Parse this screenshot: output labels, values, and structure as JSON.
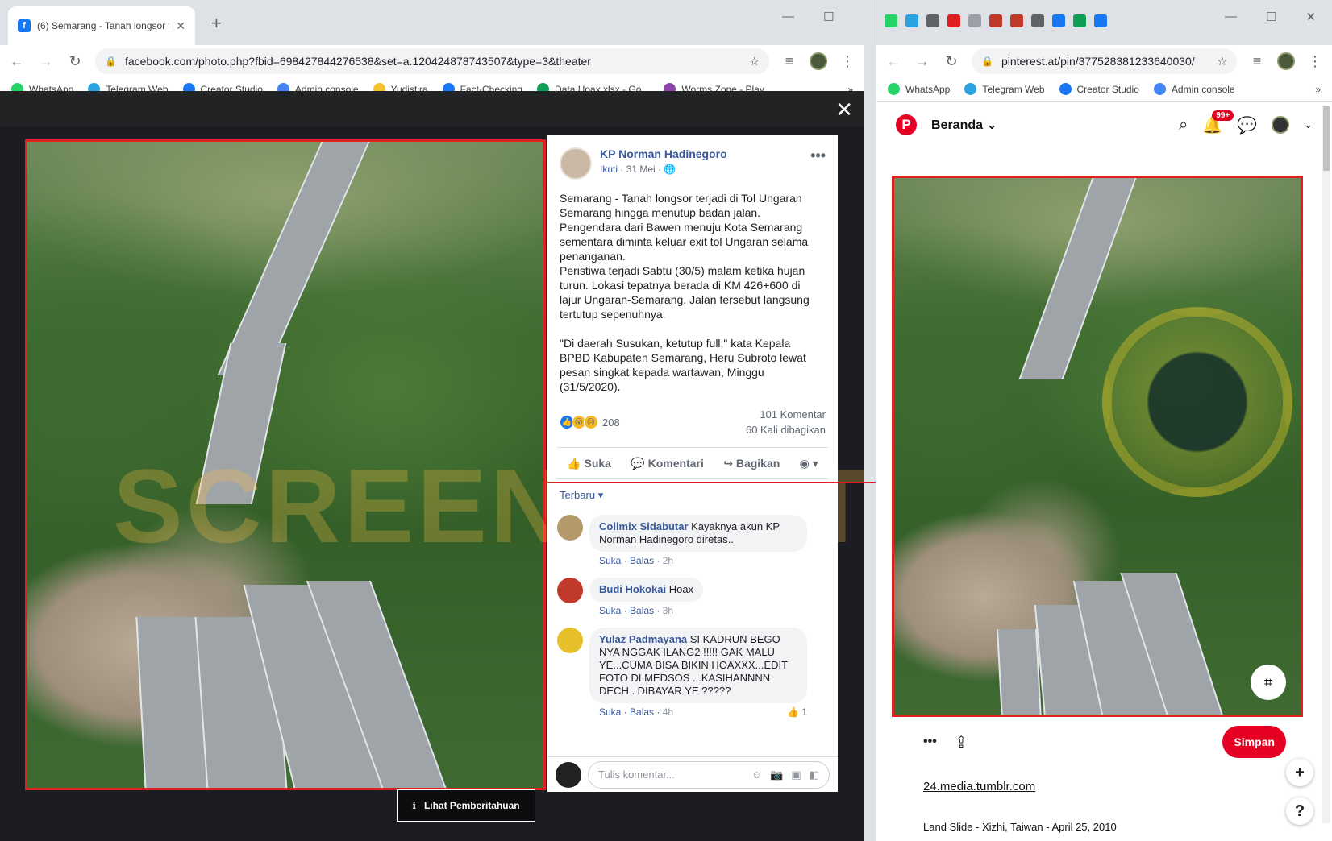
{
  "left_browser": {
    "tab_title": "(6) Semarang - Tanah longsor ter",
    "url": "facebook.com/photo.php?fbid=698427844276538&set=a.120424878743507&type=3&theater",
    "bookmarks": [
      {
        "label": "WhatsApp",
        "icon": "whatsapp-icon",
        "color": "#25d366"
      },
      {
        "label": "Telegram Web",
        "icon": "telegram-icon",
        "color": "#2aa3e0"
      },
      {
        "label": "Creator Studio",
        "icon": "facebook-icon",
        "color": "#1877f2"
      },
      {
        "label": "Admin console",
        "icon": "gear-icon",
        "color": "#4285f4"
      },
      {
        "label": "Yudistira",
        "icon": "yudistira-icon",
        "color": "#f3c32f"
      },
      {
        "label": "Fact-Checking",
        "icon": "facebook-icon",
        "color": "#1877f2"
      },
      {
        "label": "Data Hoax.xlsx - Go...",
        "icon": "sheets-icon",
        "color": "#0f9d58"
      },
      {
        "label": "Worms.Zone - Play...",
        "icon": "worms-icon",
        "color": "#8e44ad"
      }
    ]
  },
  "fb": {
    "author": "KP Norman Hadinegoro",
    "follow": "Ikuti",
    "date": "31 Mei",
    "post_text": "Semarang - Tanah longsor terjadi di Tol Ungaran\nSemarang hingga menutup badan jalan.\nPengendara dari Bawen menuju Kota Semarang\nsementara diminta keluar exit tol Ungaran selama\npenanganan.\nPeristiwa terjadi Sabtu (30/5) malam ketika hujan\nturun. Lokasi tepatnya berada di KM 426+600 di\nlajur Ungaran-Semarang. Jalan tersebut langsung\ntertutup sepenuhnya.\n\n\"Di daerah Susukan, ketutup full,\" kata Kepala\nBPBD Kabupaten Semarang, Heru Subroto lewat\npesan singkat kepada wartawan, Minggu\n(31/5/2020).",
    "reaction_count": "208",
    "comments_count": "101 Komentar",
    "shares_count": "60 Kali dibagikan",
    "like_label": "Suka",
    "comment_label": "Komentari",
    "share_label": "Bagikan",
    "sort_label": "Terbaru ▾",
    "notice_label": "Lihat Pemberitahuan",
    "watermark": "SCREENSHOT BY",
    "compose_placeholder": "Tulis komentar...",
    "comments": [
      {
        "name": "Collmix Sidabutar",
        "text": "Kayaknya akun KP Norman Hadinegoro diretas..",
        "like": "Suka",
        "reply": "Balas",
        "time": "2h",
        "avatar_color": "#b49a6a"
      },
      {
        "name": "Budi Hokokai",
        "text": "Hoax",
        "like": "Suka",
        "reply": "Balas",
        "time": "3h",
        "avatar_color": "#c0392b"
      },
      {
        "name": "Yulaz Padmayana",
        "text": "SI KADRUN BEGO NYA NGGAK ILANG2 !!!!! GAK MALU YE...CUMA BISA BIKIN HOAXXX...EDIT FOTO DI MEDSOS ...KASIHANNNN DECH . DIBAYAR YE ?????",
        "like": "Suka",
        "reply": "Balas",
        "time": "4h",
        "likes": "1",
        "avatar_color": "#e6c02a"
      }
    ]
  },
  "right_browser": {
    "url": "pinterest.at/pin/377528381233640030/",
    "bookmarks": [
      {
        "label": "WhatsApp",
        "icon": "whatsapp-icon",
        "color": "#25d366"
      },
      {
        "label": "Telegram Web",
        "icon": "telegram-icon",
        "color": "#2aa3e0"
      },
      {
        "label": "Creator Studio",
        "icon": "facebook-icon",
        "color": "#1877f2"
      },
      {
        "label": "Admin console",
        "icon": "gear-icon",
        "color": "#4285f4"
      }
    ]
  },
  "pin": {
    "home_label": "Beranda",
    "notif_badge": "99+",
    "save_label": "Simpan",
    "source_link": "24.media.tumblr.com",
    "caption": "Land Slide - Xizhi, Taiwan - April 25, 2010",
    "more_label": "•••",
    "add_label": "+",
    "help_label": "?"
  },
  "colors": {
    "highlight": "#e02020",
    "pinterest": "#e60023",
    "facebook": "#1877f2"
  }
}
